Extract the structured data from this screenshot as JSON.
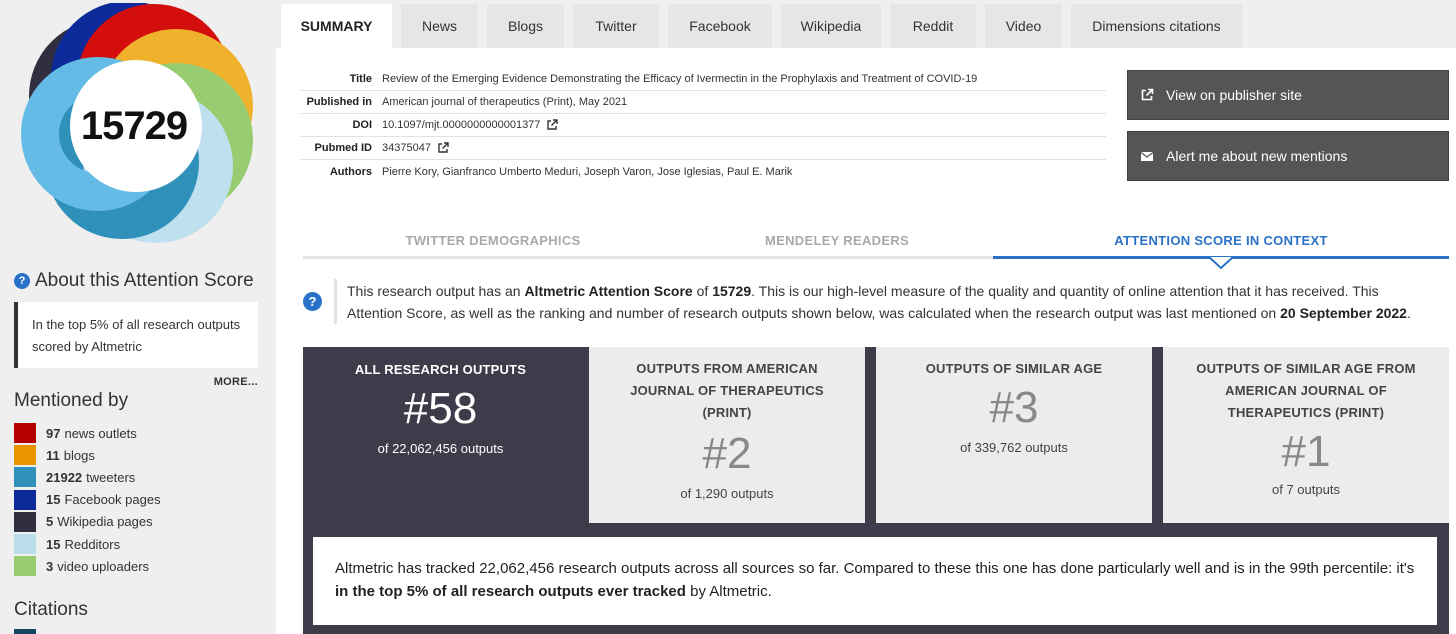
{
  "sidebar": {
    "score": "15729",
    "about_title": "About this Attention Score",
    "about_text": "In the top 5% of all research outputs scored by Altmetric",
    "more_label": "MORE...",
    "mentioned_title": "Mentioned by",
    "mentions": [
      {
        "count": "97",
        "label": "news outlets",
        "color": "#b60000"
      },
      {
        "count": "11",
        "label": "blogs",
        "color": "#e89500"
      },
      {
        "count": "21922",
        "label": "tweeters",
        "color": "#2f90b9"
      },
      {
        "count": "15",
        "label": "Facebook pages",
        "color": "#071d70"
      },
      {
        "count": "5",
        "label": "Wikipedia pages",
        "color": "#2f2f3f"
      },
      {
        "count": "15",
        "label": "Redditors",
        "color": "#b9ddeb"
      },
      {
        "count": "3",
        "label": "video uploaders",
        "color": "#98cc70"
      }
    ],
    "citations_title": "Citations"
  },
  "tabs": [
    "SUMMARY",
    "News",
    "Blogs",
    "Twitter",
    "Facebook",
    "Wikipedia",
    "Reddit",
    "Video",
    "Dimensions citations"
  ],
  "details": {
    "title_label": "Title",
    "title_value": "Review of the Emerging Evidence Demonstrating the Efficacy of Ivermectin in the Prophylaxis and Treatment of COVID-19",
    "published_label": "Published in",
    "published_value": "American journal of therapeutics (Print), May 2021",
    "doi_label": "DOI",
    "doi_value": "10.1097/mjt.0000000000001377",
    "pubmed_label": "Pubmed ID",
    "pubmed_value": "34375047",
    "authors_label": "Authors",
    "authors_value": "Pierre Kory, Gianfranco Umberto Meduri, Joseph Varon, Jose Iglesias, Paul E. Marik"
  },
  "actions": {
    "publisher": "View on publisher site",
    "alert": "Alert me about new mentions"
  },
  "subtabs": {
    "twitter": "TWITTER DEMOGRAPHICS",
    "mendeley": "MENDELEY READERS",
    "context": "ATTENTION SCORE IN CONTEXT"
  },
  "context": {
    "t1": "This research output has an ",
    "t2": "Altmetric Attention Score",
    "t3": " of ",
    "t4": "15729",
    "t5": ". This is our high-level measure of the quality and quantity of online attention that it has received. This Attention Score, as well as the ranking and number of research outputs shown below, was calculated when the research output was last mentioned on ",
    "t6": "20 September 2022",
    "t7": "."
  },
  "cards": [
    {
      "title": "ALL RESEARCH OUTPUTS",
      "rank": "#58",
      "sub": "of 22,062,456 outputs"
    },
    {
      "title": "OUTPUTS FROM AMERICAN JOURNAL OF THERAPEUTICS (PRINT)",
      "rank": "#2",
      "sub": "of 1,290 outputs"
    },
    {
      "title": "OUTPUTS OF SIMILAR AGE",
      "rank": "#3",
      "sub": "of 339,762 outputs"
    },
    {
      "title": "OUTPUTS OF SIMILAR AGE FROM AMERICAN JOURNAL OF THERAPEUTICS (PRINT)",
      "rank": "#1",
      "sub": "of 7 outputs"
    }
  ],
  "summary": {
    "s1": "Altmetric has tracked 22,062,456 research outputs across all sources so far. Compared to these this one has done particularly well and is in the 99th percentile: it's ",
    "s2": "in the top 5% of all research outputs ever tracked",
    "s3": " by Altmetric."
  },
  "colors": {
    "accent": "#2a72c7",
    "dark_panel": "#3c3c4a",
    "button": "#555555"
  }
}
